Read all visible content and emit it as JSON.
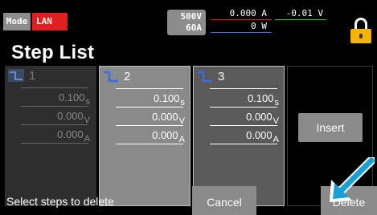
{
  "status_bar": {
    "mode_label": "Mode",
    "interface_label": "LAN",
    "rating_voltage": "500V",
    "rating_current": "60A",
    "measured_current": "0.000 A",
    "measured_voltage": "-0.01 V",
    "measured_power": "0 W",
    "lock_state": "unlocked"
  },
  "page_title": "Step List",
  "steps": [
    {
      "number": "1",
      "time": "0.100",
      "time_unit": "s",
      "voltage": "0.000",
      "voltage_unit": "V",
      "current": "0.000",
      "current_unit": "A",
      "state": "unselected"
    },
    {
      "number": "2",
      "time": "0.100",
      "time_unit": "s",
      "voltage": "0.000",
      "voltage_unit": "V",
      "current": "0.000",
      "current_unit": "A",
      "state": "selected"
    },
    {
      "number": "3",
      "time": "0.100",
      "time_unit": "s",
      "voltage": "0.000",
      "voltage_unit": "V",
      "current": "0.000",
      "current_unit": "A",
      "state": "selected"
    }
  ],
  "insert_label": "Insert",
  "hint_text": "Select steps to delete",
  "cancel_label": "Cancel",
  "delete_label": "Delete",
  "colors": {
    "lan_badge": "#e02020",
    "lock": "#f5b400",
    "step_icon": "#3a6ee0",
    "arrow": "#1aa0d8"
  },
  "icons": [
    "lock-icon",
    "step-icon",
    "pointer-arrow-icon"
  ]
}
